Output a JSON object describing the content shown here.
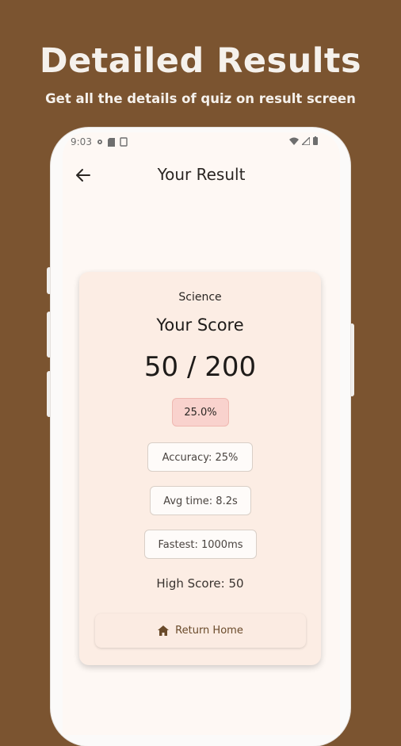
{
  "promo": {
    "title": "Detailed Results",
    "subtitle": "Get all the details of quiz on result screen"
  },
  "status_bar": {
    "time": "9:03"
  },
  "app_bar": {
    "title": "Your Result"
  },
  "result_card": {
    "subject": "Science",
    "score_label": "Your Score",
    "score_value": "50 / 200",
    "percent": "25.0%",
    "accuracy": "Accuracy: 25%",
    "avg_time": "Avg time: 8.2s",
    "fastest": "Fastest: 1000ms",
    "high_score": "High Score: 50",
    "return_button": "Return Home"
  },
  "icons": {
    "back": "arrow-left-icon",
    "home": "home-icon",
    "wifi": "wifi-icon",
    "signal": "signal-icon",
    "battery": "battery-icon"
  },
  "colors": {
    "background": "#7b5430",
    "card": "#fcede4",
    "percent_badge": "#f9d2cd",
    "accent": "#6a4a2a"
  }
}
